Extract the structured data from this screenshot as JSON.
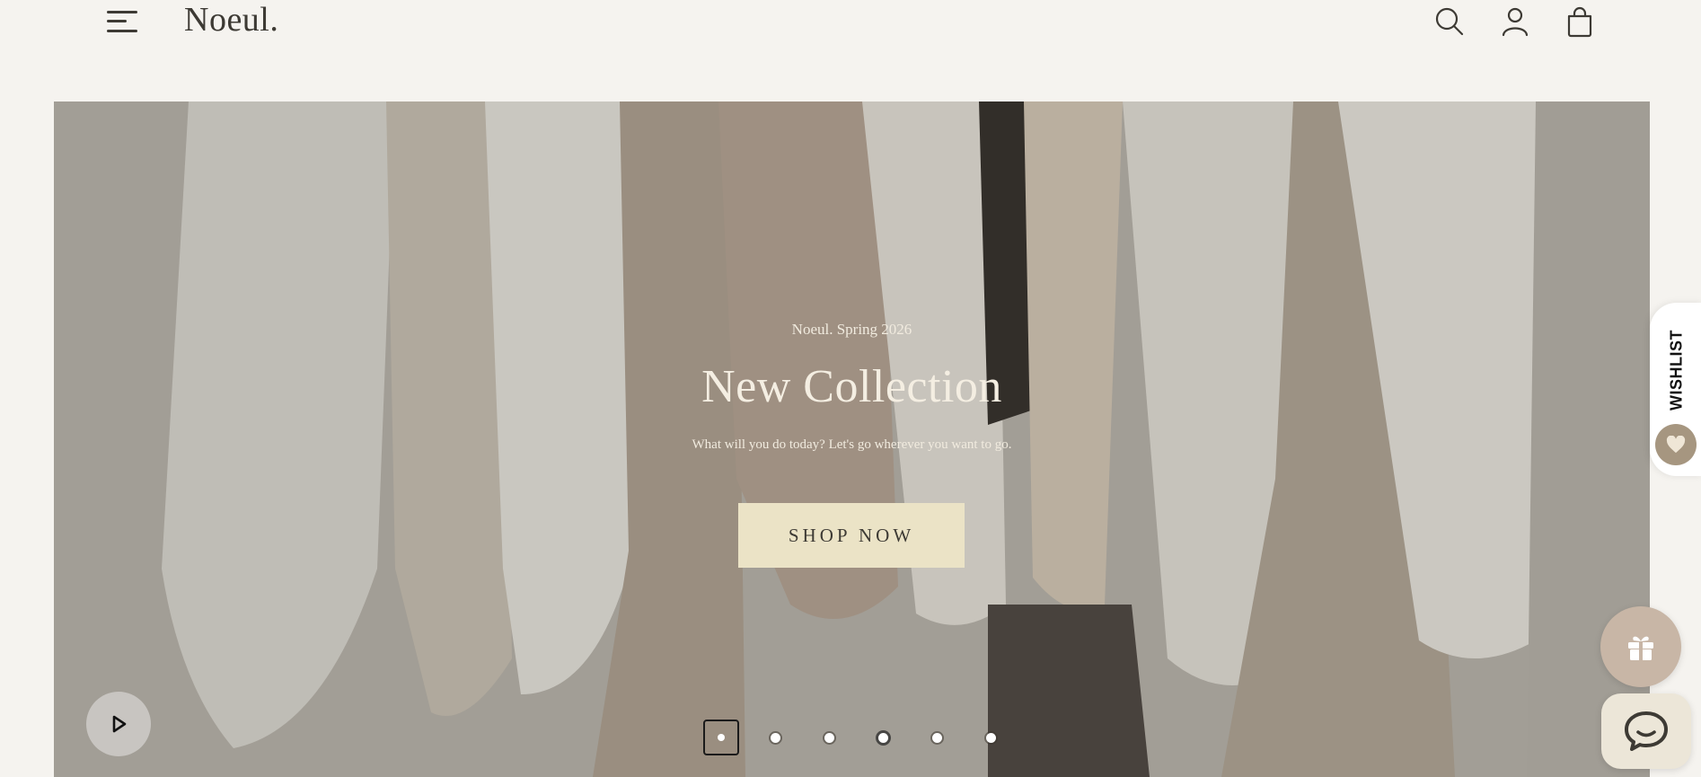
{
  "header": {
    "logo": "Noeul.",
    "menu_icon": "hamburger-menu-icon",
    "search_icon": "search-icon",
    "account_icon": "user-icon",
    "cart_icon": "shopping-bag-icon",
    "icon_color": "#3d3a34"
  },
  "hero": {
    "eyebrow": "Noeul. Spring 2026",
    "title": "New Collection",
    "subtitle": "What will you do today? Let's go wherever you want to go.",
    "cta_label": "SHOP NOW",
    "cta_color": "#ebe3c6",
    "play_icon": "play-icon",
    "slides_total": 6,
    "active_slide": 1
  },
  "floating": {
    "wishlist_label": "WISHLIST",
    "wishlist_icon": "heart-icon",
    "gift_icon": "gift-icon",
    "chat_icon": "chat-icon",
    "accent": "#a69680"
  }
}
